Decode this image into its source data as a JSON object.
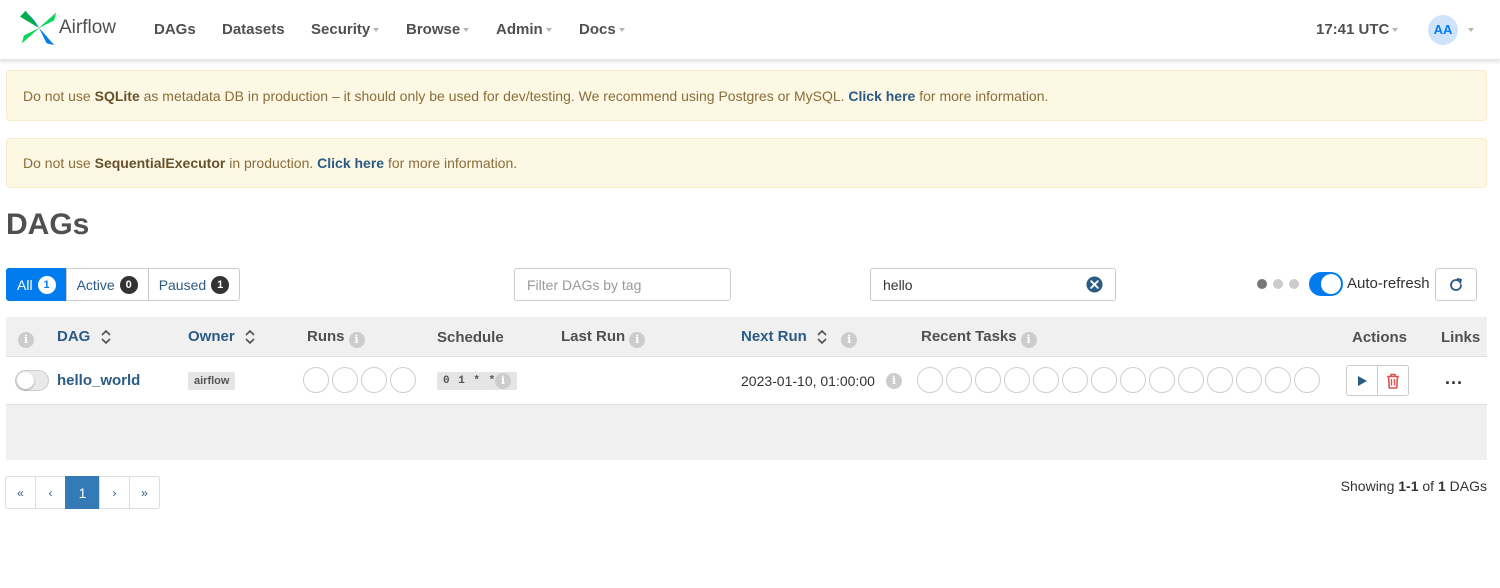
{
  "app": {
    "name": "Airflow"
  },
  "nav": {
    "items": [
      {
        "label": "DAGs",
        "dropdown": false
      },
      {
        "label": "Datasets",
        "dropdown": false
      },
      {
        "label": "Security",
        "dropdown": true
      },
      {
        "label": "Browse",
        "dropdown": true
      },
      {
        "label": "Admin",
        "dropdown": true
      },
      {
        "label": "Docs",
        "dropdown": true
      }
    ],
    "clock": "17:41 UTC",
    "avatar_initials": "AA"
  },
  "alerts": [
    {
      "pre": "Do not use ",
      "bold": "SQLite",
      "mid": " as metadata DB in production – it should only be used for dev/testing. We recommend using Postgres or MySQL. ",
      "link": "Click here",
      "post": " for more information."
    },
    {
      "pre": "Do not use ",
      "bold": "SequentialExecutor",
      "mid": " in production. ",
      "link": "Click here",
      "post": " for more information."
    }
  ],
  "page_title": "DAGs",
  "status_filter": {
    "buttons": [
      {
        "label": "All",
        "count": "1",
        "active": true
      },
      {
        "label": "Active",
        "count": "0",
        "active": false
      },
      {
        "label": "Paused",
        "count": "1",
        "active": false
      }
    ]
  },
  "tag_filter": {
    "placeholder": "Filter DAGs by tag"
  },
  "search": {
    "value": "hello"
  },
  "auto_refresh": {
    "label": "Auto-refresh",
    "enabled": true
  },
  "table": {
    "headers": {
      "dag": "DAG",
      "owner": "Owner",
      "runs": "Runs",
      "schedule": "Schedule",
      "last_run": "Last Run",
      "next_run": "Next Run",
      "recent_tasks": "Recent Tasks",
      "actions": "Actions",
      "links": "Links"
    },
    "rows": [
      {
        "dag_id": "hello_world",
        "owner": "airflow",
        "schedule": "0 1 * * *",
        "last_run": "",
        "next_run": "2023-01-10, 01:00:00",
        "paused": true,
        "run_circles": 4,
        "task_circles": 14,
        "more_links": "..."
      }
    ]
  },
  "pagination": {
    "first": "«",
    "prev": "‹",
    "current": "1",
    "next": "›",
    "last": "»"
  },
  "summary": {
    "prefix": "Showing ",
    "range": "1-1",
    "of": " of ",
    "total": "1",
    "suffix": " DAGs"
  },
  "colors": {
    "primary": "#017cee",
    "link": "#2b5b84",
    "alert_bg": "#fcf8e3",
    "delete": "#d9534f"
  }
}
